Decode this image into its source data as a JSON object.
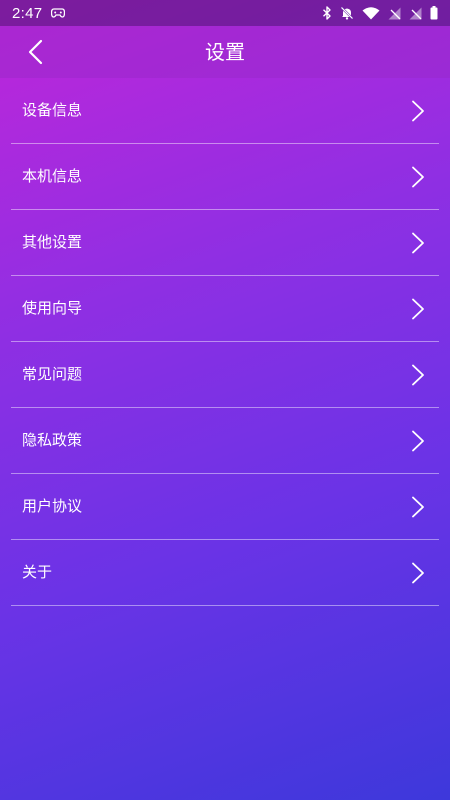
{
  "status_bar": {
    "time": "2:47",
    "icons": [
      "gamepad-icon",
      "bluetooth-icon",
      "notifications-off-icon",
      "wifi-icon",
      "signal-off-icon",
      "signal-off-icon",
      "battery-icon"
    ]
  },
  "header": {
    "title": "设置",
    "back_icon": "chevron-left-icon"
  },
  "settings": {
    "items": [
      {
        "label": "设备信息"
      },
      {
        "label": "本机信息"
      },
      {
        "label": "其他设置"
      },
      {
        "label": "使用向导"
      },
      {
        "label": "常见问题"
      },
      {
        "label": "隐私政策"
      },
      {
        "label": "用户协议"
      },
      {
        "label": "关于"
      }
    ]
  },
  "colors": {
    "gradient_start": "#c026d9",
    "gradient_end": "#3d38db",
    "divider": "#ffffff",
    "text": "#ffffff"
  }
}
